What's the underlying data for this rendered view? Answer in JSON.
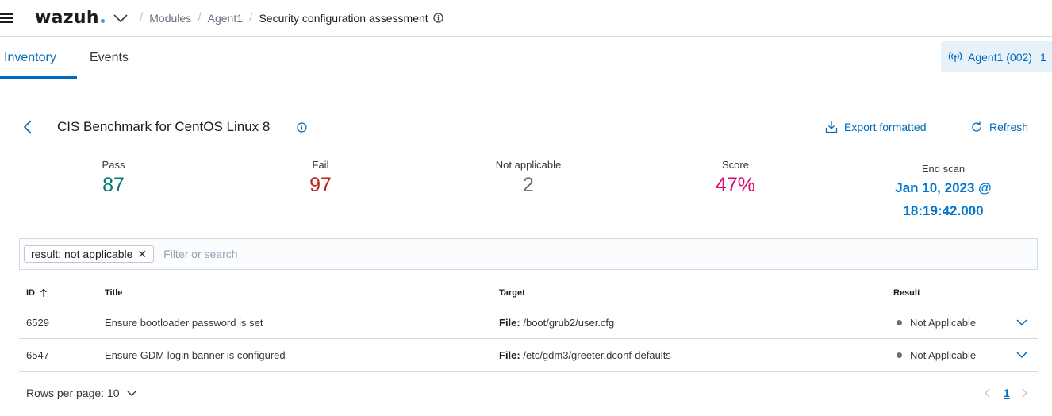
{
  "header": {
    "logo": "wazuh",
    "breadcrumbs": [
      "Modules",
      "Agent1",
      "Security configuration assessment"
    ]
  },
  "tabs": [
    {
      "label": "Inventory",
      "active": true
    },
    {
      "label": "Events",
      "active": false
    }
  ],
  "agent_button": {
    "label": "Agent1 (002)",
    "extra": "1"
  },
  "policy": {
    "title": "CIS Benchmark for CentOS Linux 8",
    "export_label": "Export formatted",
    "refresh_label": "Refresh"
  },
  "stats": {
    "pass": {
      "label": "Pass",
      "value": "87",
      "color": "#017d73"
    },
    "fail": {
      "label": "Fail",
      "value": "97",
      "color": "#bd271e"
    },
    "not_applicable": {
      "label": "Not applicable",
      "value": "2",
      "color": "#69707d"
    },
    "score": {
      "label": "Score",
      "value": "47%",
      "color": "#dd0a73"
    },
    "end_scan": {
      "label": "End scan",
      "value_line1": "Jan 10, 2023 @",
      "value_line2": "18:19:42.000"
    }
  },
  "search": {
    "filter_chip": "result: not applicable",
    "placeholder": "Filter or search"
  },
  "table": {
    "headers": [
      "ID",
      "Title",
      "Target",
      "Result"
    ],
    "rows": [
      {
        "id": "6529",
        "title": "Ensure bootloader password is set",
        "target_label": "File:",
        "target_value": "/boot/grub2/user.cfg",
        "result": "Not Applicable"
      },
      {
        "id": "6547",
        "title": "Ensure GDM login banner is configured",
        "target_label": "File:",
        "target_value": "/etc/gdm3/greeter.dconf-defaults",
        "result": "Not Applicable"
      }
    ]
  },
  "footer": {
    "rows_per_page": "Rows per page: 10",
    "current_page": "1"
  },
  "colors": {
    "accent": "#006bb8",
    "border": "#d3dae6"
  }
}
